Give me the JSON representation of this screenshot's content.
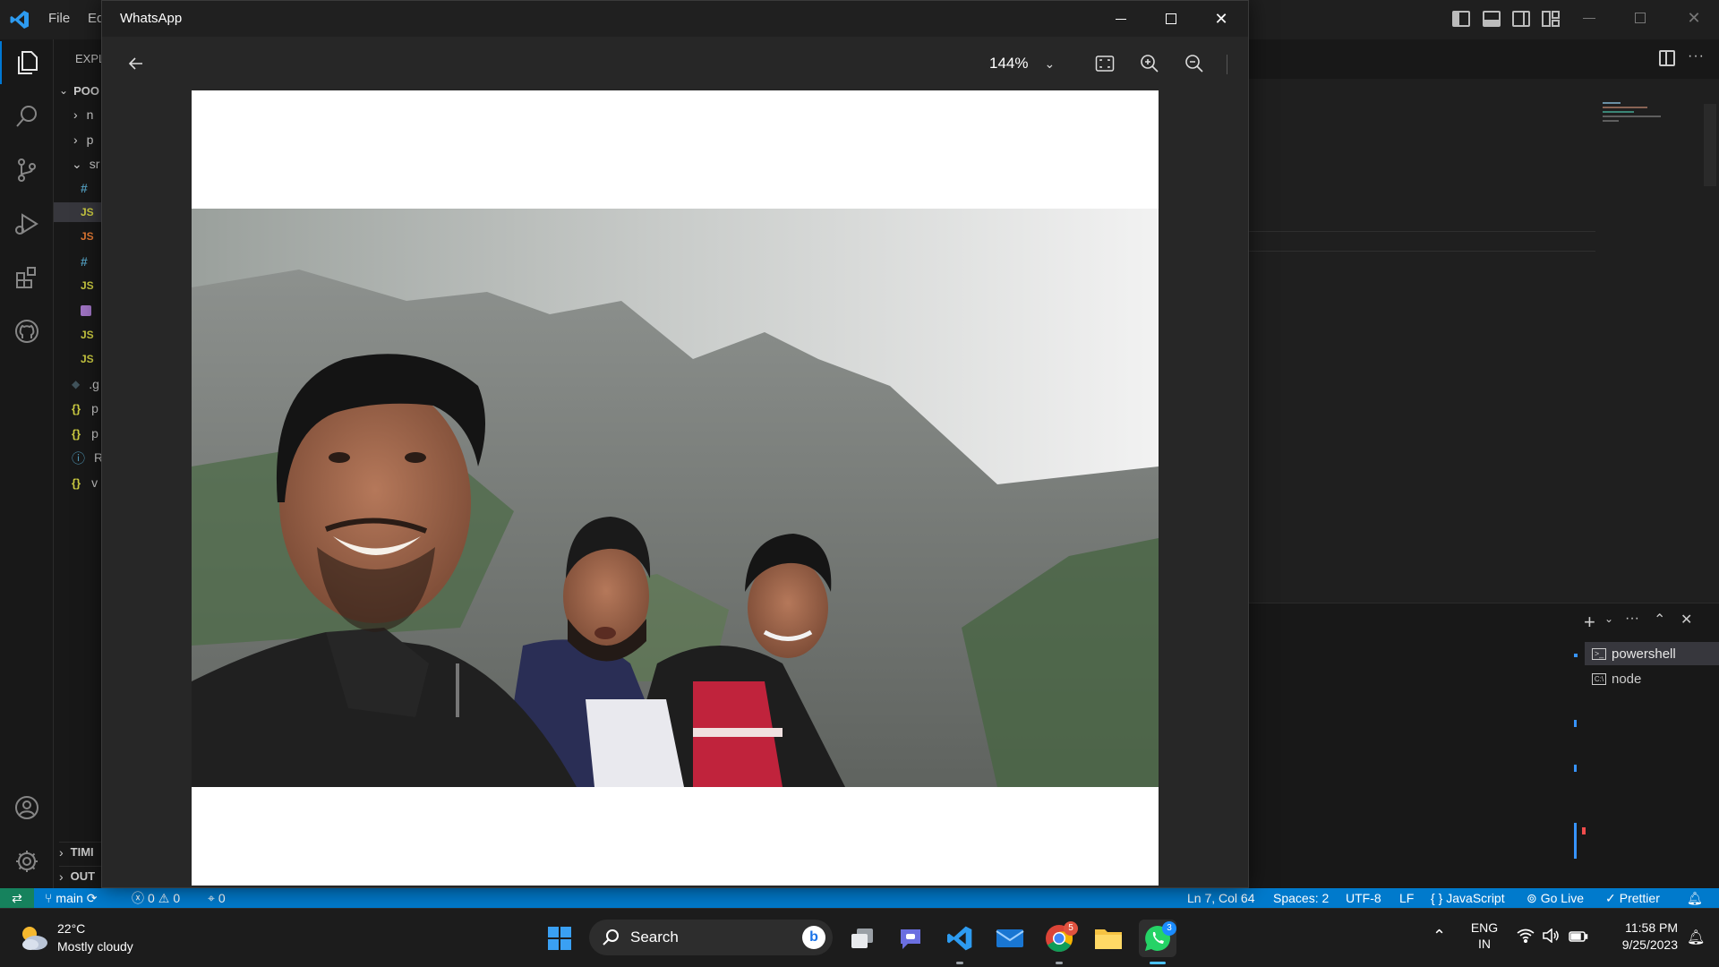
{
  "vscode": {
    "menu": [
      "File",
      "Ed"
    ],
    "explorer_title": "EXPL",
    "root_folder": "POO",
    "tree_folders": [
      "n",
      "p",
      "sr"
    ],
    "files": [
      {
        "icon": "#",
        "kind": "css",
        "label": ""
      },
      {
        "icon": "JS",
        "kind": "js",
        "label": ""
      },
      {
        "icon": "JS",
        "kind": "js-red",
        "label": ""
      },
      {
        "icon": "#",
        "kind": "css",
        "label": ""
      },
      {
        "icon": "JS",
        "kind": "js",
        "label": ""
      },
      {
        "icon": "",
        "kind": "svg",
        "label": ""
      },
      {
        "icon": "JS",
        "kind": "js",
        "label": ""
      },
      {
        "icon": "JS",
        "kind": "js",
        "label": ""
      }
    ],
    "root_files": [
      {
        "icon": "◆",
        "label": ".g"
      },
      {
        "icon": "{}",
        "label": "p"
      },
      {
        "icon": "{}",
        "label": "p"
      },
      {
        "icon": "ⓘ",
        "label": "R"
      },
      {
        "icon": "{}",
        "label": "v"
      }
    ],
    "bottom_sections": [
      "TIMI",
      "OUT"
    ],
    "terminal_tabs": [
      "powershell",
      "node"
    ],
    "status": {
      "branch": "main",
      "errors": "0",
      "warnings": "0",
      "ports": "0",
      "position": "Ln 7, Col 64",
      "spaces": "Spaces: 2",
      "encoding": "UTF-8",
      "eol": "LF",
      "language": "JavaScript",
      "golive": "Go Live",
      "prettier": "Prettier"
    }
  },
  "whatsapp": {
    "title": "WhatsApp",
    "zoom": "144%"
  },
  "taskbar": {
    "weather_temp": "22°C",
    "weather_desc": "Mostly cloudy",
    "search_placeholder": "Search",
    "lang_top": "ENG",
    "lang_bottom": "IN",
    "time": "11:58 PM",
    "date": "9/25/2023",
    "chrome_badge": "5",
    "whatsapp_badge": "3"
  },
  "colors": {
    "accent": "#007acc",
    "whatsapp": "#25d366"
  }
}
